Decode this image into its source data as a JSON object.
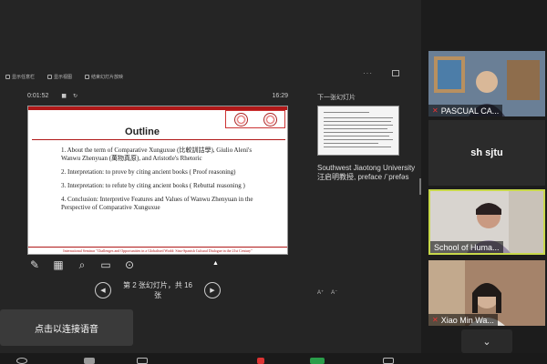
{
  "toolbar": {
    "items": [
      "显示任意栏",
      "显示视图",
      "结束幻灯片放映"
    ]
  },
  "presenter": {
    "elapsed": "0:01:52",
    "pause_icon": "pause-icon",
    "clock": "16:29",
    "next_label": "下一张幻灯片",
    "notes": "Southwest Jiaotong University 汪启明教授, preface /ˈprefəs",
    "page_indicator": "第 2 张幻灯片，共 16 张",
    "font_up": "A⁺",
    "font_down": "A⁻"
  },
  "slide": {
    "title": "Outline",
    "items": [
      "1. About the term of Comparative Xunguxue (比較訓詁學), Giulio Aleni's Wanwu Zhenyuan (萬物真原), and Aristotle's Rhetoric",
      "2. Interpretation: to prove by citing ancient books ( Proof reasoning)",
      "3. Interpretation: to refute by citing ancient books ( Rebuttal reasoning )",
      "4. Conclusion: Interpretive Features and Values of Wanwu Zhenyuan in the Perspective of Comparative Xunguxue"
    ],
    "footer": "International Seminar  \"Challenges and Opportunities in a Globalised World: Sino-Spanish Cultural Dialogue in the 21st Century\""
  },
  "toast": "点击以连接语音",
  "participants": [
    {
      "name": "PASCUAL CA...",
      "muted": true,
      "video": true
    },
    {
      "name": "sh sjtu",
      "muted": false,
      "video": false
    },
    {
      "name": "School of Huma...",
      "muted": false,
      "video": true,
      "active": true
    },
    {
      "name": "Xiao Min Wa...",
      "muted": true,
      "video": true
    }
  ],
  "colors": {
    "accent_active": "#c8d84a",
    "slide_red": "#b01818",
    "mute_red": "#e33333"
  }
}
